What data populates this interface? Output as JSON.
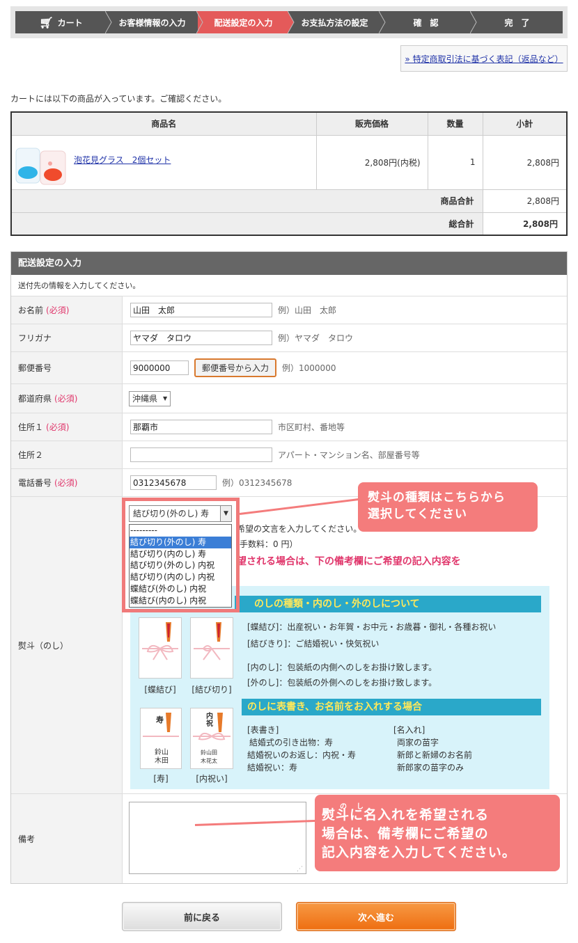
{
  "steps": [
    "カート",
    "お客様情報の入力",
    "配送設定の入力",
    "お支払方法の設定",
    "確　認",
    "完　了"
  ],
  "law_link": "» 特定商取引法に基づく表記（返品など）",
  "intro": "カートには以下の商品が入っています。ご確認ください。",
  "cart": {
    "headers": [
      "商品名",
      "販売価格",
      "数量",
      "小計"
    ],
    "item": {
      "name": "泡花見グラス　2個セット",
      "price": "2,808円(内税)",
      "qty": "1",
      "subtotal": "2,808円"
    },
    "goods_total_label": "商品合計",
    "goods_total": "2,808円",
    "grand_total_label": "総合計",
    "grand_total": "2,808円"
  },
  "form": {
    "title": "配送設定の入力",
    "desc": "送付先の情報を入力してください。",
    "required": "(必須)",
    "name": {
      "label": "お名前",
      "value": "山田　太郎",
      "example": "例）山田　太郎"
    },
    "kana": {
      "label": "フリガナ",
      "value": "ヤマダ　タロウ",
      "example": "例）ヤマダ　タロウ"
    },
    "zip": {
      "label": "郵便番号",
      "value": "9000000",
      "button": "郵便番号から入力",
      "example": "例）1000000"
    },
    "pref": {
      "label": "都道府県",
      "value": "沖縄県"
    },
    "addr1": {
      "label": "住所１",
      "value": "那覇市",
      "example": "市区町村、番地等"
    },
    "addr2": {
      "label": "住所２",
      "value": "",
      "example": "アパート・マンション名、部屋番号等"
    },
    "tel": {
      "label": "電話番号",
      "value": "0312345678",
      "example": "例）0312345678"
    },
    "noshi": {
      "label": "熨斗（のし）",
      "selected": "結び切り(外のし) 寿",
      "options": [
        "---------",
        "結び切り(外のし) 寿",
        "結び切り(内のし) 寿",
        "結び切り(外のし) 内祝",
        "結び切り(内のし) 内祝",
        "蝶結び(外のし) 内祝",
        "蝶結び(内のし) 内祝"
      ],
      "note1": "希望の文言を入力してください。",
      "note2": "手数料：0 円）",
      "note3": "望される場合は、下の備考欄にご希望の記入内容を",
      "box_title": "のしの種類・内のし・外のしについて",
      "cap_cho": "[蝶結び]",
      "cap_musubi": "[結び切り]",
      "cap_kotobuki": "[寿]",
      "cap_uchiiwai": "[内祝い]",
      "line1": "[蝶結び]：出産祝い・お年賀・お中元・お歳暮・御礼・各種お祝い",
      "line2": "[結びきり]：ご結婚祝い・快気祝い",
      "line3": "[内のし]：包装紙の内側へのしをお掛け致します。",
      "line4": "[外のし]：包装紙の外側へのしをお掛け致します。",
      "sub_title": "のしに表書き、お名前をお入れする場合",
      "omote": [
        "[表書き]",
        "結婚式の引き出物：寿",
        "結婚祝いのお返し：内祝・寿",
        "結婚祝い：寿"
      ],
      "naire": [
        "[名入れ]",
        "両家の苗字",
        "新郎と新婦のお名前",
        "新郎家の苗字のみ"
      ],
      "card_kotobuki": "寿",
      "card_uchiiwai": "内祝"
    },
    "remarks": {
      "label": "備考"
    }
  },
  "callout1": [
    "熨斗の種類はこちらから",
    "選択してください"
  ],
  "callout2": {
    "ruby": "のし",
    "lines": [
      "熨斗に名入れを希望される",
      "場合は、備考欄にご希望の",
      "記入内容を入力してください。"
    ]
  },
  "buttons": {
    "back": "前に戻る",
    "next": "次へ進む"
  },
  "colors": {
    "active_step": "#e45a5a",
    "callout": "#f47c7c",
    "next_button": "#f07a17",
    "info_head": "#2aa8c9"
  }
}
